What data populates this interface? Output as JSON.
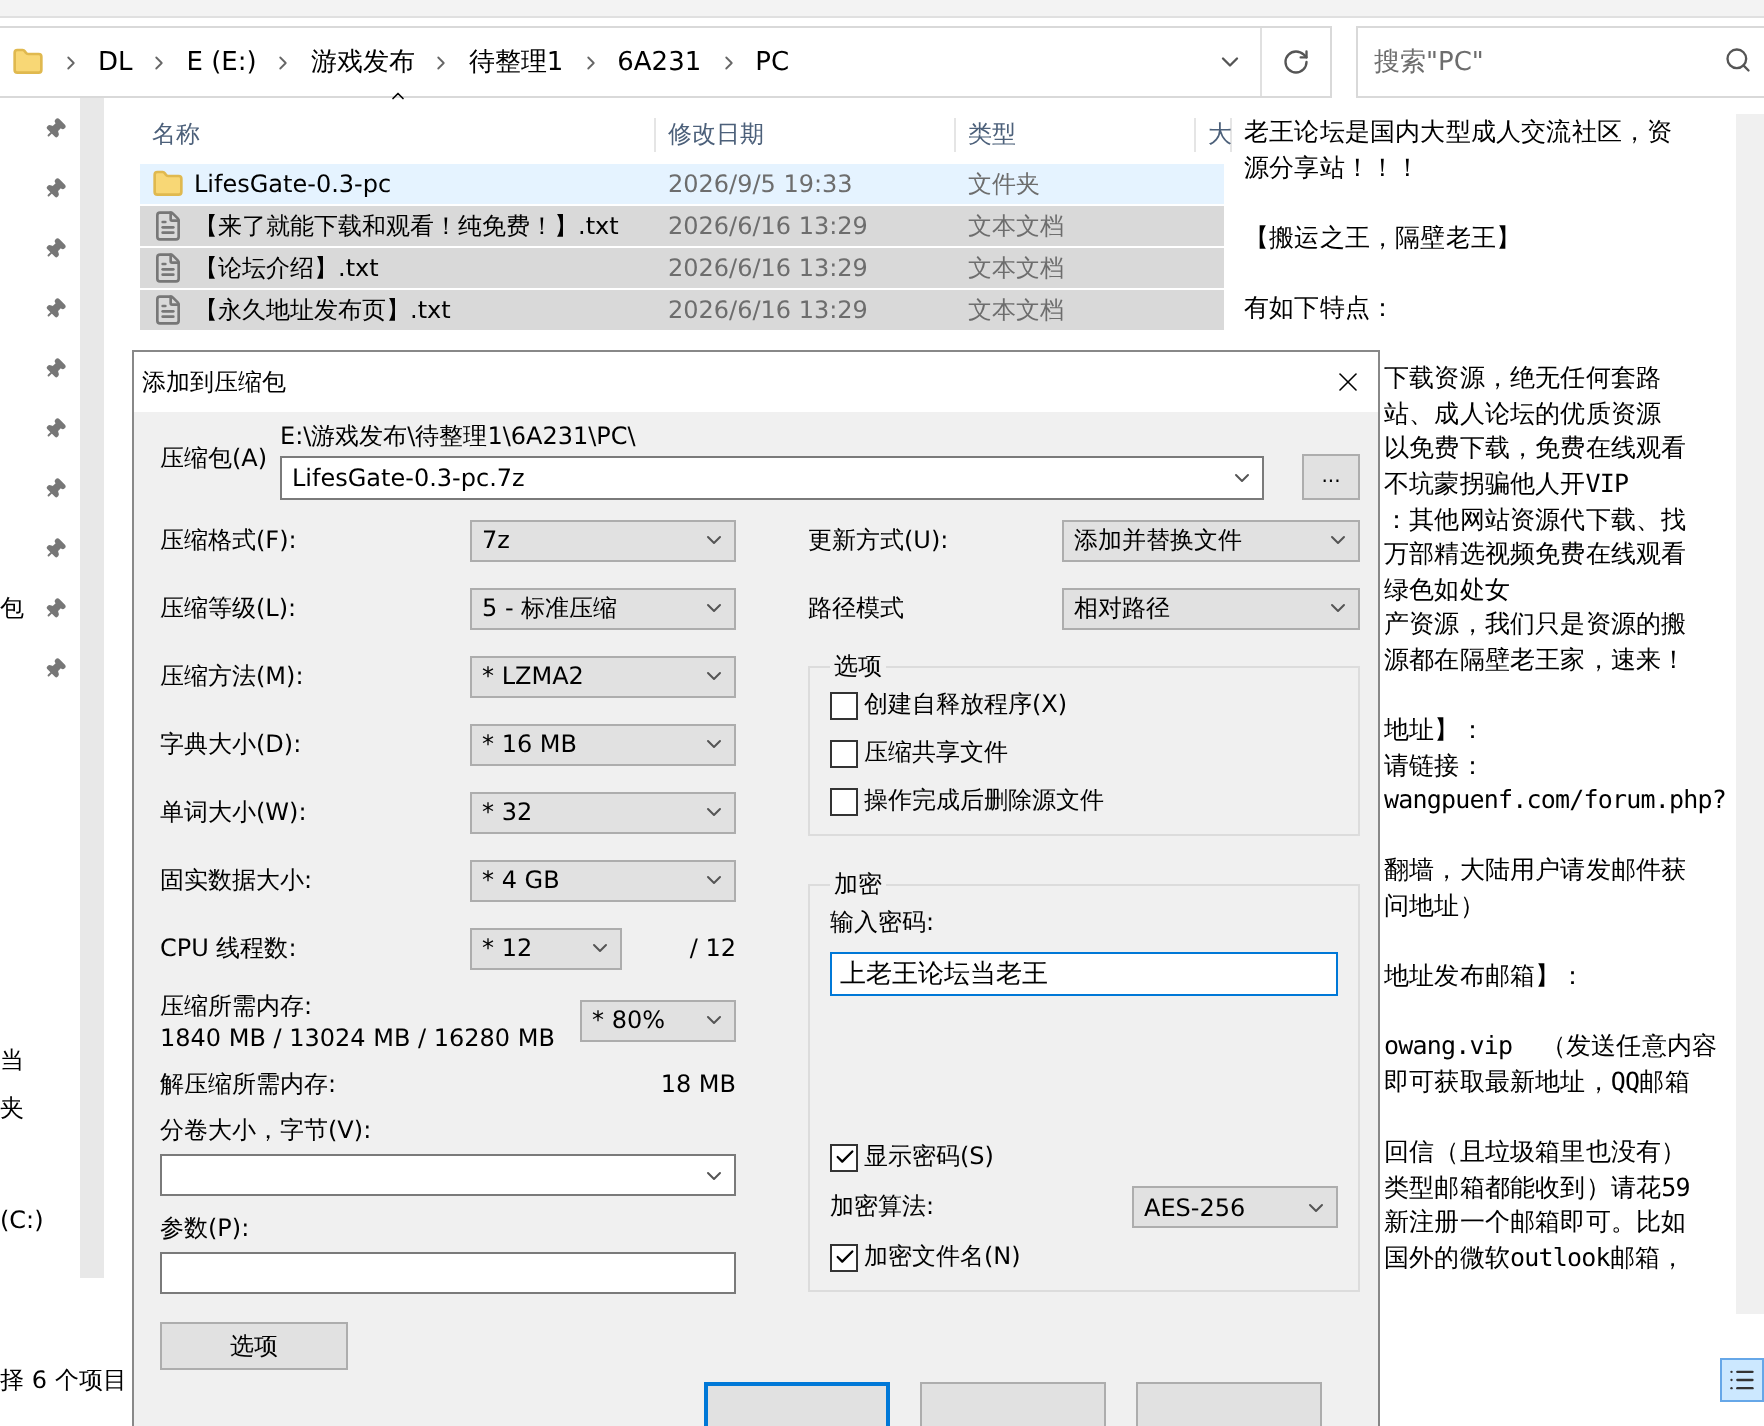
{
  "explorer": {
    "breadcrumbs": [
      "DL",
      "E (E:)",
      "游戏发布",
      "待整理1",
      "6A231",
      "PC"
    ],
    "search": {
      "placeholder": "搜索\"PC\""
    },
    "nav": [
      {
        "pinned": true
      },
      {
        "pinned": true
      },
      {
        "pinned": true
      },
      {
        "pinned": true
      },
      {
        "pinned": true
      },
      {
        "pinned": true
      },
      {
        "pinned": true
      },
      {
        "pinned": true
      },
      {
        "pinned": true,
        "label": "包"
      },
      {
        "pinned": true
      }
    ],
    "nav_lower": [
      "当",
      "夹",
      "(C:)"
    ],
    "columns": [
      "名称",
      "修改日期",
      "类型",
      "大"
    ],
    "files": [
      {
        "kind": "folder",
        "name": "LifesGate-0.3-pc",
        "date": "2026/9/5 19:33",
        "type": "文件夹",
        "hovered": true,
        "selected": false
      },
      {
        "kind": "text",
        "name": "【来了就能下载和观看！纯免费！】.txt",
        "date": "2026/6/16 13:29",
        "type": "文本文档",
        "hovered": false,
        "selected": true
      },
      {
        "kind": "text",
        "name": "【论坛介绍】.txt",
        "date": "2026/6/16 13:29",
        "type": "文本文档",
        "hovered": false,
        "selected": true
      },
      {
        "kind": "text",
        "name": "【永久地址发布页】.txt",
        "date": "2026/6/16 13:29",
        "type": "文本文档",
        "hovered": false,
        "selected": true
      }
    ],
    "status": "择 6 个项目"
  },
  "preview": {
    "top": [
      [
        "老王论坛是国内大型成人交流社区，资",
        "源分享站！！！"
      ],
      [
        "【搬运之王，隔壁老王】"
      ],
      [
        "有如下特点："
      ]
    ],
    "lower": [
      [
        "下载资源，绝无任何套路",
        "站、成人论坛的优质资源",
        "以免费下载，免费在线观看",
        "不坑蒙拐骗他人开VIP",
        "：其他网站资源代下载、找",
        "万部精选视频免费在线观看",
        "绿色如处女",
        "产资源，我们只是资源的搬",
        "源都在隔壁老王家，速来！"
      ],
      [
        "地址】：",
        "请链接：",
        "wangpuenf.com/forum.php?"
      ],
      [
        "翻墙，大陆用户请发邮件获",
        "问地址）"
      ],
      [
        "地址发布邮箱】："
      ],
      [
        "owang.vip  （发送任意内容",
        "即可获取最新地址，QQ邮箱"
      ],
      [
        "回信（且垃圾箱里也没有）",
        "类型邮箱都能收到）请花59",
        "新注册一个邮箱即可。比如",
        "国外的微软outlook邮箱，"
      ]
    ]
  },
  "dialog": {
    "title": "添加到压缩包",
    "archive": {
      "label": "压缩包(A)",
      "path": "E:\\游戏发布\\待整理1\\6A231\\PC\\",
      "value": "LifesGate-0.3-pc.7z",
      "browse": "..."
    },
    "left_fields": [
      {
        "label": "压缩格式(F):",
        "value": "7z"
      },
      {
        "label": "压缩等级(L):",
        "value": "5 - 标准压缩"
      },
      {
        "label": "压缩方法(M):",
        "value": "* LZMA2"
      },
      {
        "label": "字典大小(D):",
        "value": "* 16 MB"
      },
      {
        "label": "单词大小(W):",
        "value": "* 32"
      },
      {
        "label": "固实数据大小:",
        "value": "* 4 GB"
      }
    ],
    "threads": {
      "label": "CPU 线程数:",
      "value": "* 12",
      "max": "/ 12"
    },
    "memory": {
      "label": "压缩所需内存:",
      "detail": "1840 MB / 13024 MB / 16280 MB",
      "value": "* 80%"
    },
    "decompress_memory": {
      "label": "解压缩所需内存:",
      "value": "18 MB"
    },
    "volume": {
      "label": "分卷大小，字节(V):"
    },
    "params": {
      "label": "参数(P):"
    },
    "options_button": "选项",
    "right_fields": [
      {
        "label": "更新方式(U):",
        "value": "添加并替换文件"
      },
      {
        "label": "路径模式",
        "value": "相对路径"
      }
    ],
    "options_group": {
      "title": "选项",
      "items": [
        {
          "label": "创建自释放程序(X)",
          "checked": false
        },
        {
          "label": "压缩共享文件",
          "checked": false
        },
        {
          "label": "操作完成后删除源文件",
          "checked": false
        }
      ]
    },
    "encryption": {
      "title": "加密",
      "password_label": "输入密码:",
      "password": "上老王论坛当老王",
      "show_password": {
        "label": "显示密码(S)",
        "checked": true
      },
      "method_label": "加密算法:",
      "method": "AES-256",
      "encrypt_names": {
        "label": "加密文件名(N)",
        "checked": true
      }
    },
    "bottom_buttons": [
      {
        "default": true
      },
      {
        "default": false
      },
      {
        "default": false
      }
    ]
  }
}
